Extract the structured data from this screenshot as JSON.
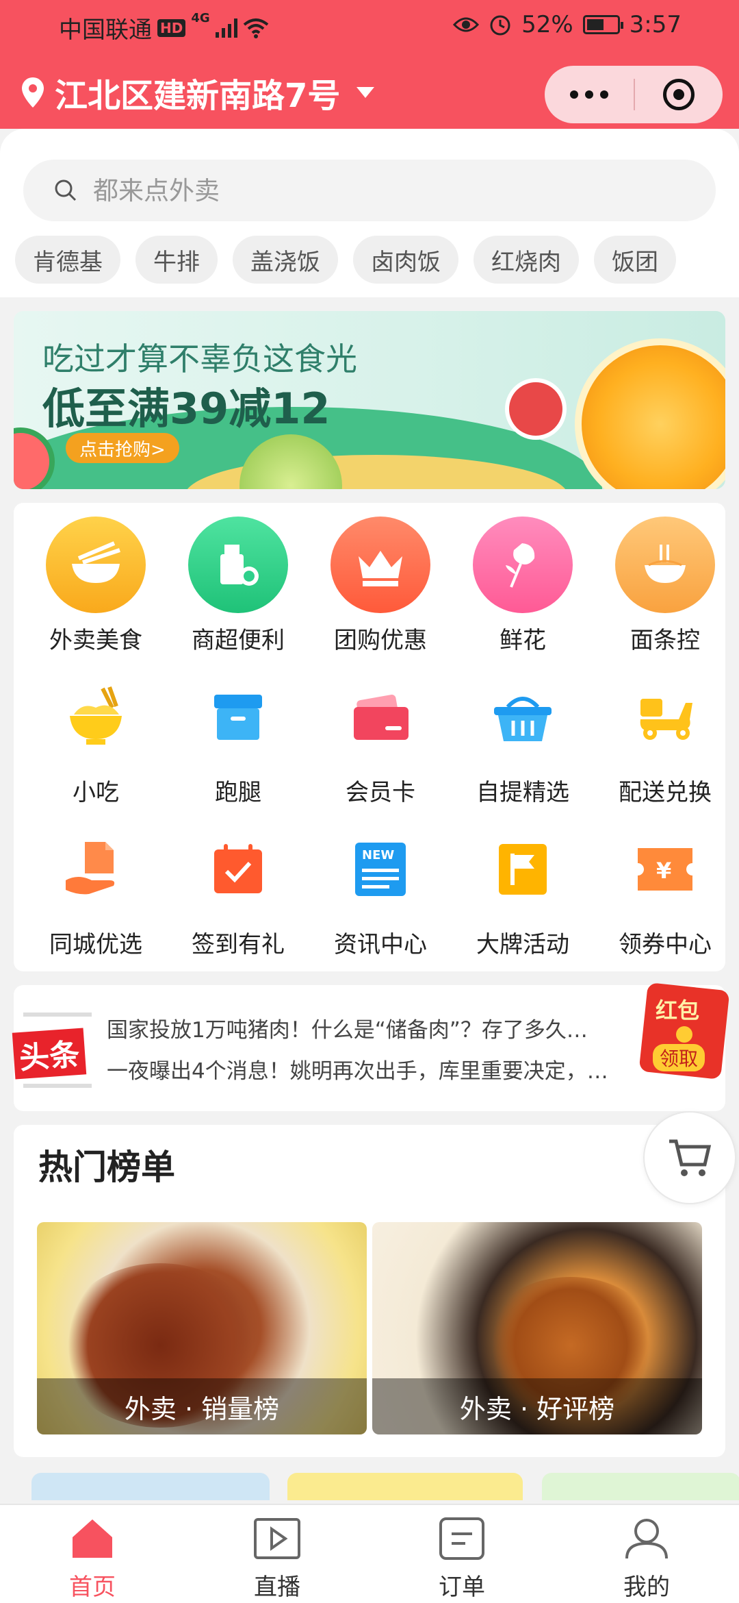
{
  "status_bar": {
    "carrier": "中国联通",
    "hd_badge": "HD",
    "network": "4G",
    "battery": "52%",
    "time": "3:57"
  },
  "header": {
    "location": "江北区建新南路7号"
  },
  "search": {
    "placeholder": "都来点外卖"
  },
  "hot_search_chips": [
    "肯德基",
    "牛排",
    "盖浇饭",
    "卤肉饭",
    "红烧肉",
    "饭团"
  ],
  "banner": {
    "headline": "吃过才算不辜负这食光",
    "offer": "低至满39减12",
    "button": "点击抢购>"
  },
  "categories": [
    {
      "label": "外卖美食",
      "icon": "bowl-chopsticks-icon",
      "color": "#fbb92c"
    },
    {
      "label": "商超便利",
      "icon": "grocery-bag-icon",
      "color": "#2fd08b"
    },
    {
      "label": "团购优惠",
      "icon": "crown-icon",
      "color": "#ff6a4e"
    },
    {
      "label": "鲜花",
      "icon": "rose-icon",
      "color": "#ff6fa8"
    },
    {
      "label": "面条控",
      "icon": "noodle-bowl-icon",
      "color": "#fbb463"
    },
    {
      "label": "小吃",
      "icon": "snack-bowl-icon",
      "color": "#ffcc1a"
    },
    {
      "label": "跑腿",
      "icon": "box-icon",
      "color": "#29a8f2"
    },
    {
      "label": "会员卡",
      "icon": "member-card-icon",
      "color": "#f2455e"
    },
    {
      "label": "自提精选",
      "icon": "basket-icon",
      "color": "#1e9bf0"
    },
    {
      "label": "配送兑换",
      "icon": "scooter-icon",
      "color": "#ffc21a"
    },
    {
      "label": "同城优选",
      "icon": "hand-bag-icon",
      "color": "#ff7a3a"
    },
    {
      "label": "签到有礼",
      "icon": "calendar-check-icon",
      "color": "#ff5a2e"
    },
    {
      "label": "资讯中心",
      "icon": "news-icon",
      "color": "#1e9bf0"
    },
    {
      "label": "大牌活动",
      "icon": "flag-icon",
      "color": "#ffb400"
    },
    {
      "label": "领券中心",
      "icon": "coupon-icon",
      "color": "#ff8a3a"
    }
  ],
  "news": {
    "logo_text": "头条",
    "items": [
      "国家投放1万吨猪肉！什么是“储备肉”？存了多久…",
      "一夜曝出4个消息！姚明再次出手，库里重要决定，…"
    ]
  },
  "red_packet": {
    "title": "红包",
    "action": "领取"
  },
  "hot_list": {
    "title": "热门榜单",
    "cards": [
      {
        "label": "外卖 · 销量榜"
      },
      {
        "label": "外卖 · 好评榜"
      }
    ]
  },
  "tabbar": [
    {
      "label": "首页",
      "icon": "home-icon",
      "active": true
    },
    {
      "label": "直播",
      "icon": "play-icon",
      "active": false
    },
    {
      "label": "订单",
      "icon": "order-icon",
      "active": false
    },
    {
      "label": "我的",
      "icon": "profile-icon",
      "active": false
    }
  ],
  "colors": {
    "brand": "#f7525f",
    "background": "#f2f2f2"
  }
}
